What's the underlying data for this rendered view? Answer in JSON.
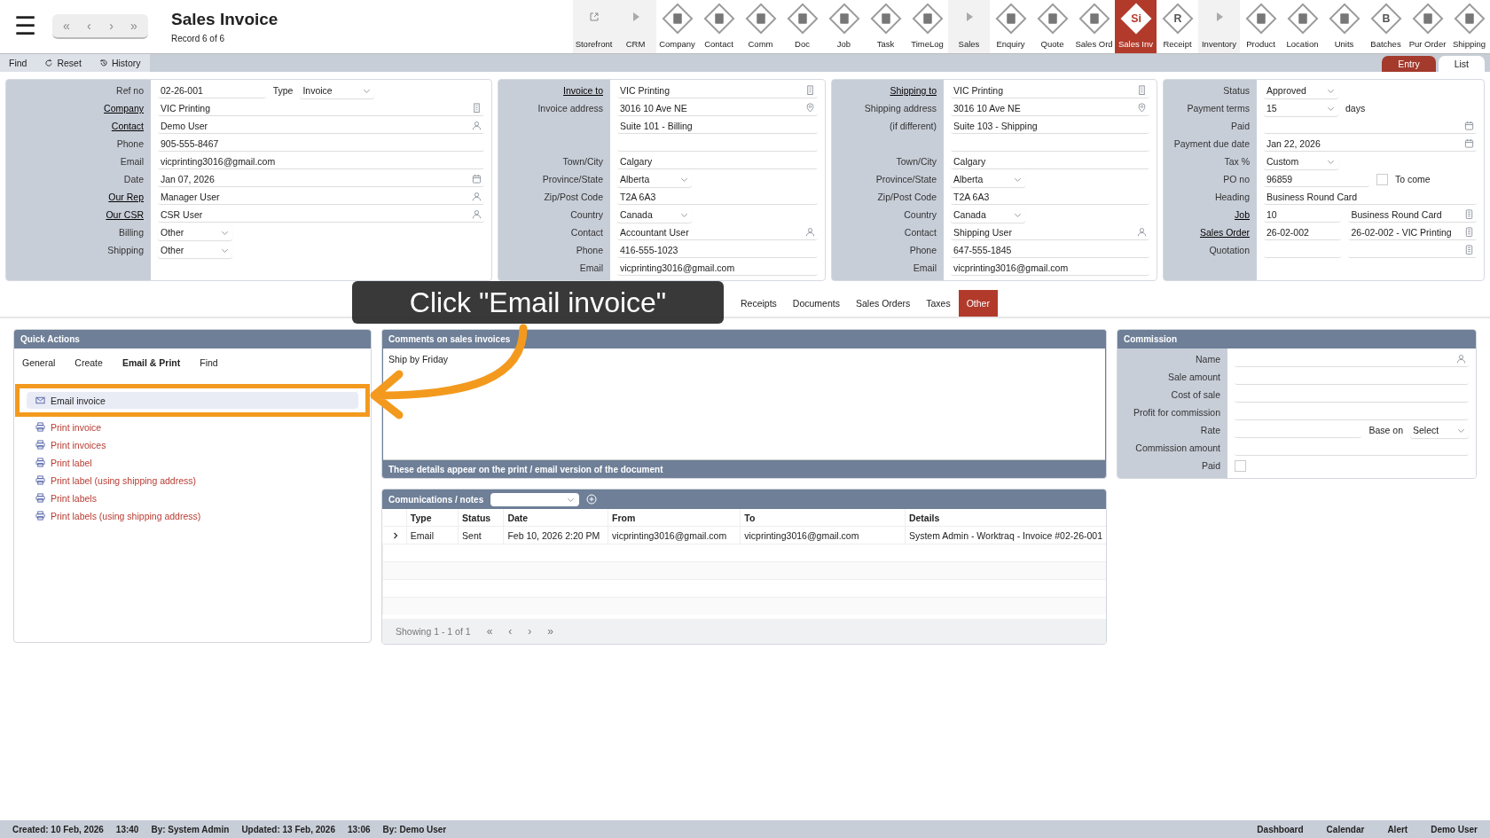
{
  "header": {
    "menu": "☰",
    "nav_buttons": [
      "«",
      "‹",
      "›",
      "»"
    ],
    "title": "Sales Invoice",
    "subtitle": "Record 6 of 6"
  },
  "modules": [
    {
      "label": "Storefront",
      "kind": "link",
      "selected": false
    },
    {
      "label": "CRM",
      "kind": "section",
      "selected": false
    },
    {
      "label": "Company",
      "kind": "module",
      "selected": false
    },
    {
      "label": "Contact",
      "kind": "module",
      "selected": false
    },
    {
      "label": "Comm",
      "kind": "module",
      "selected": false
    },
    {
      "label": "Doc",
      "kind": "module",
      "selected": false
    },
    {
      "label": "Job",
      "kind": "module",
      "selected": false
    },
    {
      "label": "Task",
      "kind": "module",
      "selected": false
    },
    {
      "label": "TimeLog",
      "kind": "module",
      "selected": false
    },
    {
      "label": "Sales",
      "kind": "section",
      "selected": false
    },
    {
      "label": "Enquiry",
      "kind": "module",
      "selected": false
    },
    {
      "label": "Quote",
      "kind": "module",
      "selected": false
    },
    {
      "label": "Sales Ord",
      "kind": "module",
      "selected": false
    },
    {
      "label": "Sales Inv",
      "kind": "module",
      "glyph": "Si",
      "selected": true
    },
    {
      "label": "Receipt",
      "kind": "module",
      "glyph": "R",
      "selected": false
    },
    {
      "label": "Inventory",
      "kind": "section",
      "selected": false
    },
    {
      "label": "Product",
      "kind": "module",
      "selected": false
    },
    {
      "label": "Location",
      "kind": "module",
      "selected": false
    },
    {
      "label": "Units",
      "kind": "module",
      "selected": false
    },
    {
      "label": "Batches",
      "kind": "module",
      "glyph": "B",
      "selected": false
    },
    {
      "label": "Pur Order",
      "kind": "module",
      "selected": false
    },
    {
      "label": "Shipping",
      "kind": "module",
      "selected": false
    }
  ],
  "toolbar": {
    "actions": [
      {
        "label": "Find",
        "kind": "plain"
      },
      {
        "label": "Reset",
        "kind": "reset"
      },
      {
        "label": "History",
        "kind": "history"
      }
    ],
    "views": [
      {
        "label": "Entry",
        "selected": true
      },
      {
        "label": "List",
        "selected": false
      }
    ]
  },
  "panels": [
    {
      "rows": [
        {
          "label": "Ref no",
          "link": false,
          "fields": [
            {
              "kind": "text",
              "value": "02-26-001"
            },
            {
              "kind": "label",
              "text": "Type"
            },
            {
              "kind": "select",
              "value": "Invoice"
            },
            {
              "kind": "gap"
            }
          ]
        },
        {
          "label": "Company",
          "link": true,
          "fields": [
            {
              "kind": "company",
              "value": "VIC Printing"
            }
          ]
        },
        {
          "label": "Contact",
          "link": true,
          "fields": [
            {
              "kind": "person",
              "value": "Demo User"
            }
          ]
        },
        {
          "label": "Phone",
          "link": false,
          "fields": [
            {
              "kind": "text",
              "value": "905-555-8467"
            }
          ]
        },
        {
          "label": "Email",
          "link": false,
          "fields": [
            {
              "kind": "text",
              "value": "vicprinting3016@gmail.com"
            }
          ]
        },
        {
          "label": "Date",
          "link": false,
          "fields": [
            {
              "kind": "date",
              "value": "Jan 07, 2026"
            }
          ]
        },
        {
          "label": "Our Rep",
          "link": true,
          "fields": [
            {
              "kind": "person",
              "value": "Manager User"
            }
          ]
        },
        {
          "label": "Our CSR",
          "link": true,
          "fields": [
            {
              "kind": "person",
              "value": "CSR User"
            }
          ]
        },
        {
          "label": "Billing",
          "link": false,
          "fields": [
            {
              "kind": "select",
              "value": "Other"
            },
            {
              "kind": "gap"
            }
          ]
        },
        {
          "label": "Shipping",
          "link": false,
          "fields": [
            {
              "kind": "select",
              "value": "Other"
            },
            {
              "kind": "gap"
            }
          ]
        }
      ]
    },
    {
      "rows": [
        {
          "label": "Invoice to",
          "link": true,
          "fields": [
            {
              "kind": "company",
              "value": "VIC Printing"
            }
          ]
        },
        {
          "label": "Invoice address",
          "link": false,
          "fields": [
            {
              "kind": "place",
              "value": "3016 10 Ave NE"
            }
          ]
        },
        {
          "fields": [
            {
              "kind": "text",
              "value": "Suite 101 - Billing"
            }
          ]
        },
        {
          "fields": [
            {
              "kind": "text"
            }
          ]
        },
        {
          "label": "Town/City",
          "link": false,
          "fields": [
            {
              "kind": "text",
              "value": "Calgary"
            }
          ]
        },
        {
          "label": "Province/State",
          "link": false,
          "fields": [
            {
              "kind": "select",
              "value": "Alberta"
            },
            {
              "kind": "gap"
            }
          ]
        },
        {
          "label": "Zip/Post Code",
          "link": false,
          "fields": [
            {
              "kind": "text",
              "value": "T2A 6A3"
            }
          ]
        },
        {
          "label": "Country",
          "link": false,
          "fields": [
            {
              "kind": "select",
              "value": "Canada"
            },
            {
              "kind": "gap"
            }
          ]
        },
        {
          "label": "Contact",
          "link": false,
          "fields": [
            {
              "kind": "person",
              "value": "Accountant User"
            }
          ]
        },
        {
          "label": "Phone",
          "link": false,
          "fields": [
            {
              "kind": "text",
              "value": "416-555-1023"
            }
          ]
        },
        {
          "label": "Email",
          "link": false,
          "fields": [
            {
              "kind": "text",
              "value": "vicprinting3016@gmail.com"
            }
          ]
        }
      ]
    },
    {
      "rows": [
        {
          "label": "Shipping to",
          "link": true,
          "fields": [
            {
              "kind": "company",
              "value": "VIC Printing"
            }
          ]
        },
        {
          "label": "Shipping address",
          "link": false,
          "fields": [
            {
              "kind": "place",
              "value": "3016 10 Ave NE"
            }
          ]
        },
        {
          "label": "(if different)",
          "link": false,
          "fields": [
            {
              "kind": "text",
              "value": "Suite 103 - Shipping"
            }
          ]
        },
        {
          "fields": [
            {
              "kind": "text"
            }
          ]
        },
        {
          "label": "Town/City",
          "link": false,
          "fields": [
            {
              "kind": "text",
              "value": "Calgary"
            }
          ]
        },
        {
          "label": "Province/State",
          "link": false,
          "fields": [
            {
              "kind": "select",
              "value": "Alberta"
            },
            {
              "kind": "gap"
            }
          ]
        },
        {
          "label": "Zip/Post Code",
          "link": false,
          "fields": [
            {
              "kind": "text",
              "value": "T2A 6A3"
            }
          ]
        },
        {
          "label": "Country",
          "link": false,
          "fields": [
            {
              "kind": "select",
              "value": "Canada"
            },
            {
              "kind": "gap"
            }
          ]
        },
        {
          "label": "Contact",
          "link": false,
          "fields": [
            {
              "kind": "person",
              "value": "Shipping User"
            }
          ]
        },
        {
          "label": "Phone",
          "link": false,
          "fields": [
            {
              "kind": "text",
              "value": "647-555-1845"
            }
          ]
        },
        {
          "label": "Email",
          "link": false,
          "fields": [
            {
              "kind": "text",
              "value": "vicprinting3016@gmail.com"
            }
          ]
        }
      ]
    },
    {
      "rows": [
        {
          "label": "Status",
          "link": false,
          "fields": [
            {
              "kind": "select",
              "value": "Approved"
            },
            {
              "kind": "gap"
            }
          ]
        },
        {
          "label": "Payment terms",
          "link": false,
          "fields": [
            {
              "kind": "select",
              "value": "15"
            },
            {
              "kind": "label",
              "text": "days"
            },
            {
              "kind": "gap"
            }
          ]
        },
        {
          "label": "Paid",
          "link": false,
          "fields": [
            {
              "kind": "date"
            }
          ]
        },
        {
          "label": "Payment due date",
          "link": false,
          "fields": [
            {
              "kind": "date",
              "value": "Jan 22, 2026"
            }
          ]
        },
        {
          "label": "Tax %",
          "link": false,
          "fields": [
            {
              "kind": "select",
              "value": "Custom"
            },
            {
              "kind": "gap"
            }
          ]
        },
        {
          "label": "PO no",
          "link": false,
          "fields": [
            {
              "kind": "text",
              "value": "96859"
            },
            {
              "kind": "checkbox",
              "text": "To come",
              "checked": false
            }
          ]
        },
        {
          "label": "Heading",
          "link": false,
          "fields": [
            {
              "kind": "text",
              "value": "Business Round Card"
            }
          ]
        },
        {
          "label": "Job",
          "link": true,
          "fields": [
            {
              "kind": "text",
              "value": "10"
            },
            {
              "kind": "doc",
              "value": "Business Round Card"
            }
          ]
        },
        {
          "label": "Sales Order",
          "link": true,
          "fields": [
            {
              "kind": "text",
              "value": "26-02-002"
            },
            {
              "kind": "doc",
              "value": "26-02-002 - VIC Printing"
            }
          ]
        },
        {
          "label": "Quotation",
          "link": false,
          "fields": [
            {
              "kind": "text"
            },
            {
              "kind": "doc"
            }
          ]
        }
      ]
    }
  ],
  "record_tabs": [
    {
      "label": "Receipts",
      "selected": false
    },
    {
      "label": "Documents",
      "selected": false
    },
    {
      "label": "Sales Orders",
      "selected": false
    },
    {
      "label": "Taxes",
      "selected": false
    },
    {
      "label": "Other",
      "selected": true
    }
  ],
  "quick_actions": {
    "title": "Quick Actions",
    "tabs": [
      {
        "label": "General",
        "selected": false
      },
      {
        "label": "Create",
        "selected": false
      },
      {
        "label": "Email & Print",
        "selected": true
      },
      {
        "label": "Find",
        "selected": false
      }
    ],
    "items": [
      {
        "label": "Email invoice",
        "kind": "email",
        "selected": true
      },
      {
        "label": "Print invoice",
        "kind": "print",
        "selected": false
      },
      {
        "label": "Print invoices",
        "kind": "print",
        "selected": false
      },
      {
        "label": "Print label",
        "kind": "print",
        "selected": false
      },
      {
        "label": "Print label (using shipping address)",
        "kind": "print",
        "selected": false
      },
      {
        "label": "Print labels",
        "kind": "print",
        "selected": false
      },
      {
        "label": "Print labels (using shipping address)",
        "kind": "print",
        "selected": false
      }
    ]
  },
  "comments": {
    "title": "Comments on sales invoices",
    "value": "Ship by Friday",
    "note": "These details appear on the print / email version of the document"
  },
  "commission": {
    "title": "Commission",
    "rows": [
      {
        "label": "Name",
        "link": false,
        "fields": [
          {
            "kind": "person"
          }
        ]
      },
      {
        "label": "Sale amount",
        "link": false,
        "fields": [
          {
            "kind": "text"
          }
        ]
      },
      {
        "label": "Cost of sale",
        "link": false,
        "fields": [
          {
            "kind": "text"
          }
        ]
      },
      {
        "label": "Profit for commission",
        "link": false,
        "fields": [
          {
            "kind": "text"
          }
        ]
      },
      {
        "label": "Rate",
        "link": false,
        "fields": [
          {
            "kind": "text"
          },
          {
            "kind": "label",
            "text": "Base on"
          },
          {
            "kind": "select",
            "value": "Select"
          }
        ]
      },
      {
        "label": "Commission amount",
        "link": false,
        "fields": [
          {
            "kind": "text"
          }
        ]
      },
      {
        "label": "Paid",
        "link": false,
        "fields": [
          {
            "kind": "checkbox",
            "checked": false
          },
          {
            "kind": "gap"
          }
        ]
      }
    ]
  },
  "communications": {
    "title": "Comunications / notes",
    "columns": [
      "Type",
      "Status",
      "Date",
      "From",
      "To",
      "Details"
    ],
    "rows": [
      {
        "cells": [
          "Email",
          "Sent",
          "Feb 10, 2026 2:20 PM",
          "vicprinting3016@gmail.com",
          "vicprinting3016@gmail.com",
          "System Admin - Worktraq - Invoice #02-26-001"
        ]
      }
    ],
    "pager": {
      "text": "Showing 1 - 1 of 1",
      "buttons": [
        "«",
        "‹",
        "›",
        "»"
      ]
    }
  },
  "footer": {
    "info": [
      "Created: 10 Feb, 2026",
      "13:40",
      "By: System Admin",
      "Updated: 13 Feb, 2026",
      "13:06",
      "By: Demo User"
    ],
    "links": [
      "Dashboard",
      "Calendar",
      "Alert",
      "Demo User"
    ]
  },
  "callout": {
    "text": "Click \"Email invoice\""
  }
}
